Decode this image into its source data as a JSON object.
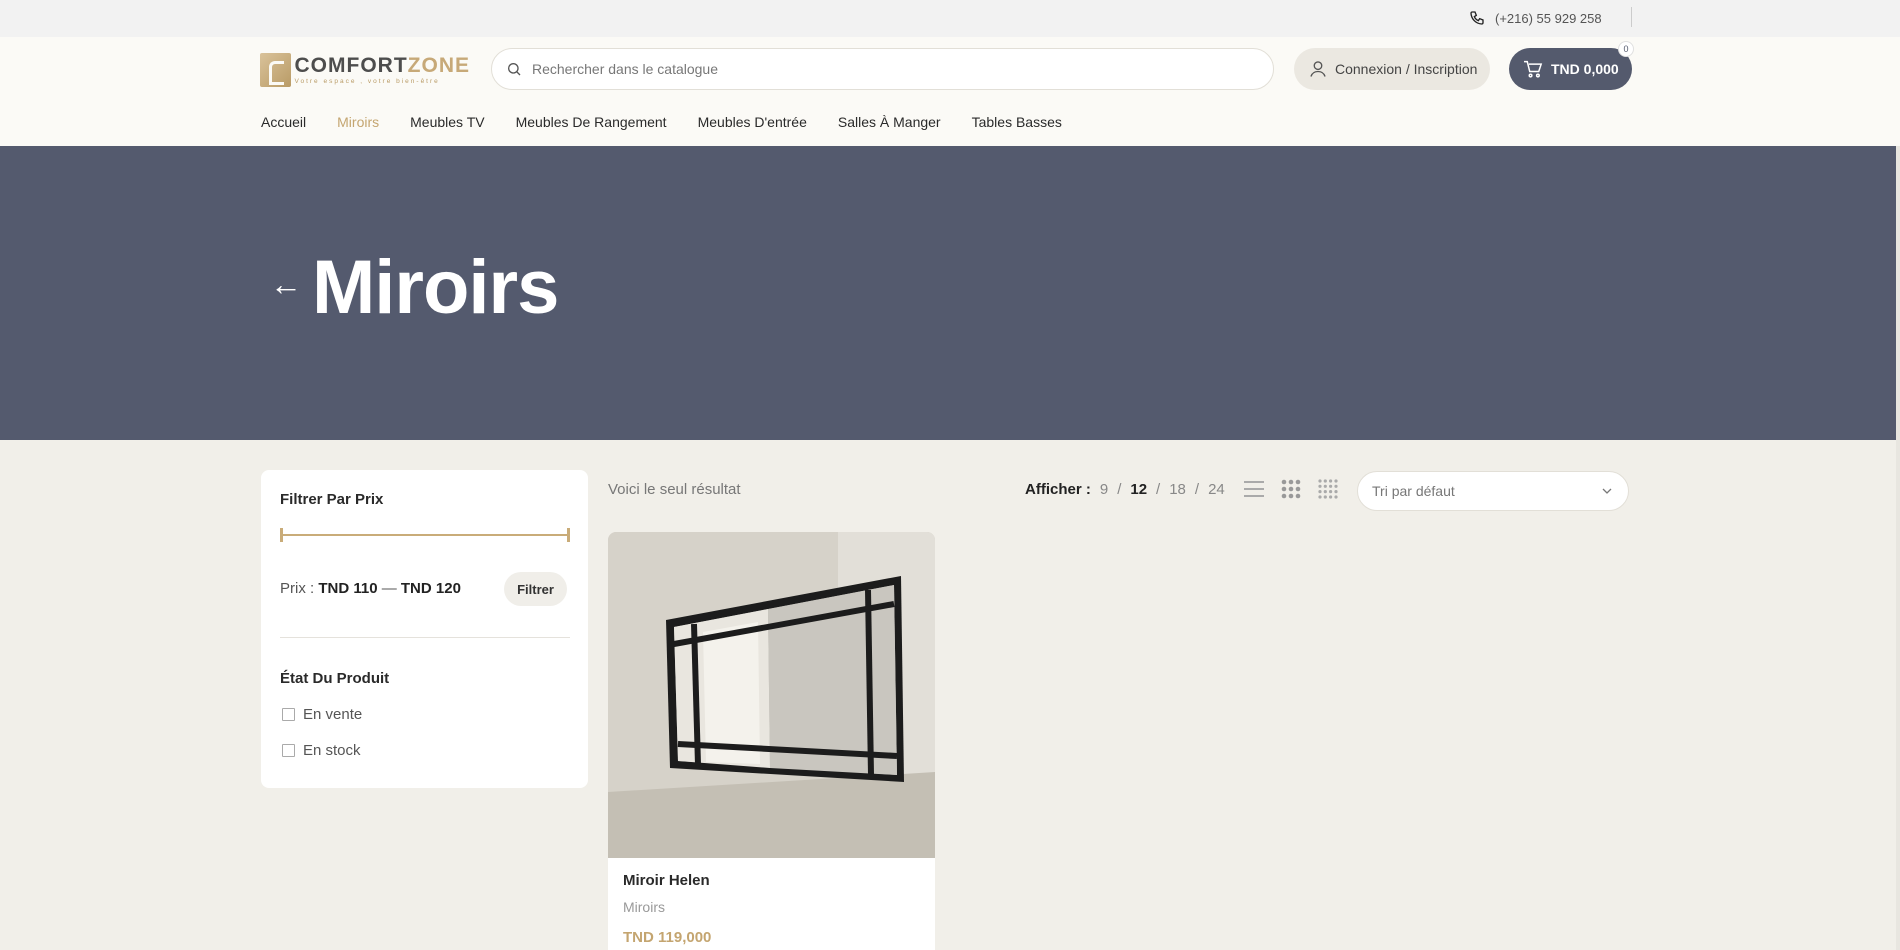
{
  "topbar": {
    "phone": "(+216) 55 929 258"
  },
  "logo": {
    "word1": "COMFORT",
    "word2": "ZONE",
    "tagline": "Votre espace , votre bien-être"
  },
  "search": {
    "placeholder": "Rechercher dans le catalogue"
  },
  "account": {
    "label": "Connexion / Inscription"
  },
  "cart": {
    "total": "TND 0,000",
    "count": "0"
  },
  "nav": {
    "items": [
      "Accueil",
      "Miroirs",
      "Meubles TV",
      "Meubles De Rangement",
      "Meubles D'entrée",
      "Salles À Manger",
      "Tables Basses"
    ],
    "active": "Miroirs"
  },
  "hero": {
    "back_glyph": "←",
    "title": "Miroirs"
  },
  "sidebar": {
    "price_title": "Filtrer Par Prix",
    "price_prefix": "Prix :",
    "price_min": "TND 110",
    "price_sep": "—",
    "price_max": "TND 120",
    "filter_button": "Filtrer",
    "status_title": "État Du Produit",
    "options": [
      "En vente",
      "En stock"
    ]
  },
  "toolbar": {
    "results": "Voici le seul résultat",
    "show_label": "Afficher :",
    "per_page": [
      "9",
      "12",
      "18",
      "24"
    ],
    "per_page_current": "12",
    "sort_selected": "Tri par défaut"
  },
  "product": {
    "name": "Miroir Helen",
    "category": "Miroirs",
    "price": "TND 119,000"
  },
  "colors": {
    "hero": "#545a6e",
    "accent": "#c4a570",
    "cart": "#545a6d",
    "page": "#f1efe9"
  }
}
